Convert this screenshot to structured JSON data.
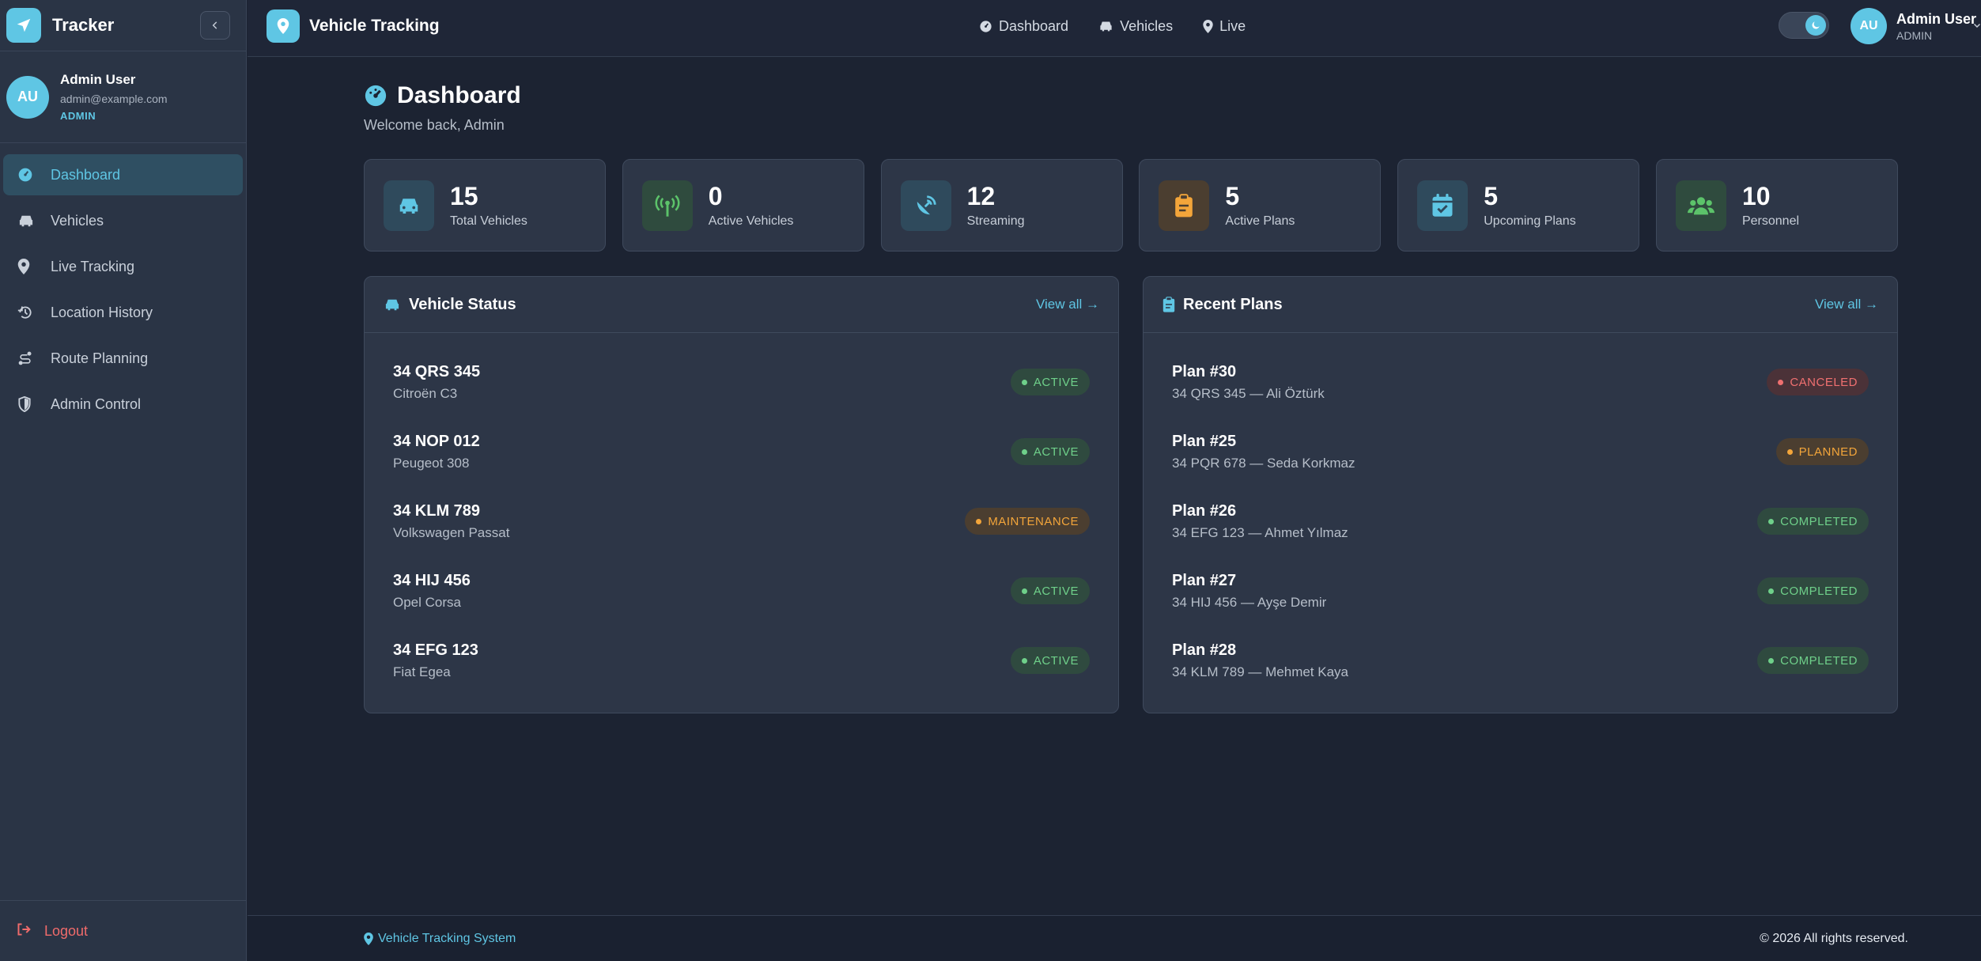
{
  "sidebar": {
    "brand": "Tracker",
    "collapse_icon": "chevron-left-icon",
    "user": {
      "initials": "AU",
      "name": "Admin User",
      "email": "admin@example.com",
      "role": "ADMIN"
    },
    "items": [
      {
        "label": "Dashboard",
        "icon": "gauge-icon",
        "active": true
      },
      {
        "label": "Vehicles",
        "icon": "car-icon"
      },
      {
        "label": "Live Tracking",
        "icon": "map-pin-icon"
      },
      {
        "label": "Location History",
        "icon": "history-icon"
      },
      {
        "label": "Route Planning",
        "icon": "route-icon"
      },
      {
        "label": "Admin Control",
        "icon": "shield-icon"
      }
    ],
    "logout": "Logout"
  },
  "topbar": {
    "title": "Vehicle Tracking",
    "nav": [
      {
        "label": "Dashboard",
        "icon": "gauge-icon"
      },
      {
        "label": "Vehicles",
        "icon": "car-icon"
      },
      {
        "label": "Live",
        "icon": "map-pin-icon"
      }
    ],
    "theme_toggle": "moon-icon",
    "user": {
      "initials": "AU",
      "name": "Admin User",
      "role": "ADMIN"
    }
  },
  "page": {
    "title": "Dashboard",
    "subtitle": "Welcome back, Admin"
  },
  "stats": [
    {
      "value": "15",
      "label": "Total Vehicles",
      "icon": "car-icon",
      "color": "#5fc6e4"
    },
    {
      "value": "0",
      "label": "Active Vehicles",
      "icon": "broadcast-icon",
      "color": "#5cc36a"
    },
    {
      "value": "12",
      "label": "Streaming",
      "icon": "satellite-dish-icon",
      "color": "#5fc6e4"
    },
    {
      "value": "5",
      "label": "Active Plans",
      "icon": "clipboard-icon",
      "color": "#f3a53a"
    },
    {
      "value": "5",
      "label": "Upcoming Plans",
      "icon": "calendar-check-icon",
      "color": "#5fc6e4"
    },
    {
      "value": "10",
      "label": "Personnel",
      "icon": "users-icon",
      "color": "#5cc36a"
    }
  ],
  "vehicle_status": {
    "title": "Vehicle Status",
    "view_all": "View all →",
    "rows": [
      {
        "plate": "34 QRS 345",
        "model": "Citroën C3",
        "status": "ACTIVE",
        "tone": "green"
      },
      {
        "plate": "34 NOP 012",
        "model": "Peugeot 308",
        "status": "ACTIVE",
        "tone": "green"
      },
      {
        "plate": "34 KLM 789",
        "model": "Volkswagen Passat",
        "status": "MAINTENANCE",
        "tone": "orange"
      },
      {
        "plate": "34 HIJ 456",
        "model": "Opel Corsa",
        "status": "ACTIVE",
        "tone": "green"
      },
      {
        "plate": "34 EFG 123",
        "model": "Fiat Egea",
        "status": "ACTIVE",
        "tone": "green"
      }
    ]
  },
  "recent_plans": {
    "title": "Recent Plans",
    "view_all": "View all →",
    "rows": [
      {
        "plan": "Plan #30",
        "detail": "34 QRS 345 — Ali Öztürk",
        "status": "CANCELED",
        "tone": "red"
      },
      {
        "plan": "Plan #25",
        "detail": "34 PQR 678 — Seda Korkmaz",
        "status": "PLANNED",
        "tone": "orange"
      },
      {
        "plan": "Plan #26",
        "detail": "34 EFG 123 — Ahmet Yılmaz",
        "status": "COMPLETED",
        "tone": "green"
      },
      {
        "plan": "Plan #27",
        "detail": "34 HIJ 456 — Ayşe Demir",
        "status": "COMPLETED",
        "tone": "green"
      },
      {
        "plan": "Plan #28",
        "detail": "34 KLM 789 — Mehmet Kaya",
        "status": "COMPLETED",
        "tone": "green"
      }
    ]
  },
  "footer": {
    "left": "Vehicle Tracking System",
    "right": "© 2026 All rights reserved."
  }
}
